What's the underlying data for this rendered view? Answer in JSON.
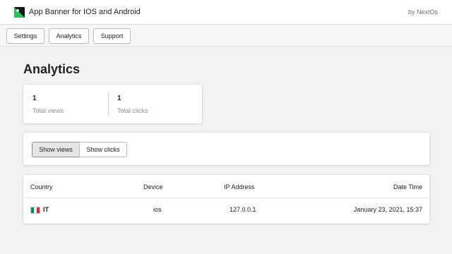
{
  "header": {
    "app_title": "App Banner for IOS and Android",
    "by_line": "by NextOs"
  },
  "nav": {
    "items": [
      {
        "label": "Settings"
      },
      {
        "label": "Analytics"
      },
      {
        "label": "Support"
      }
    ]
  },
  "page": {
    "title": "Analytics"
  },
  "stats": {
    "views_value": "1",
    "views_label": "Total views",
    "clicks_value": "1",
    "clicks_label": "Total clicks"
  },
  "toggle": {
    "show_views": "Show views",
    "show_clicks": "Show clicks",
    "active": "show_views"
  },
  "table": {
    "headers": {
      "country": "Country",
      "device": "Device",
      "ip": "IP Address",
      "datetime": "Date Time"
    },
    "rows": [
      {
        "country": "IT",
        "flag_colors": [
          "#009246",
          "#ffffff",
          "#ce2b37"
        ],
        "device": "ios",
        "ip": "127.0.0.1",
        "datetime": "January 23, 2021, 15:37"
      }
    ]
  },
  "colors": {
    "brand": "#2fbf57",
    "page_bg": "#f1f2f3"
  },
  "icons": {
    "logo": "app-banner-logo-icon",
    "flag": "italy-flag-icon"
  }
}
